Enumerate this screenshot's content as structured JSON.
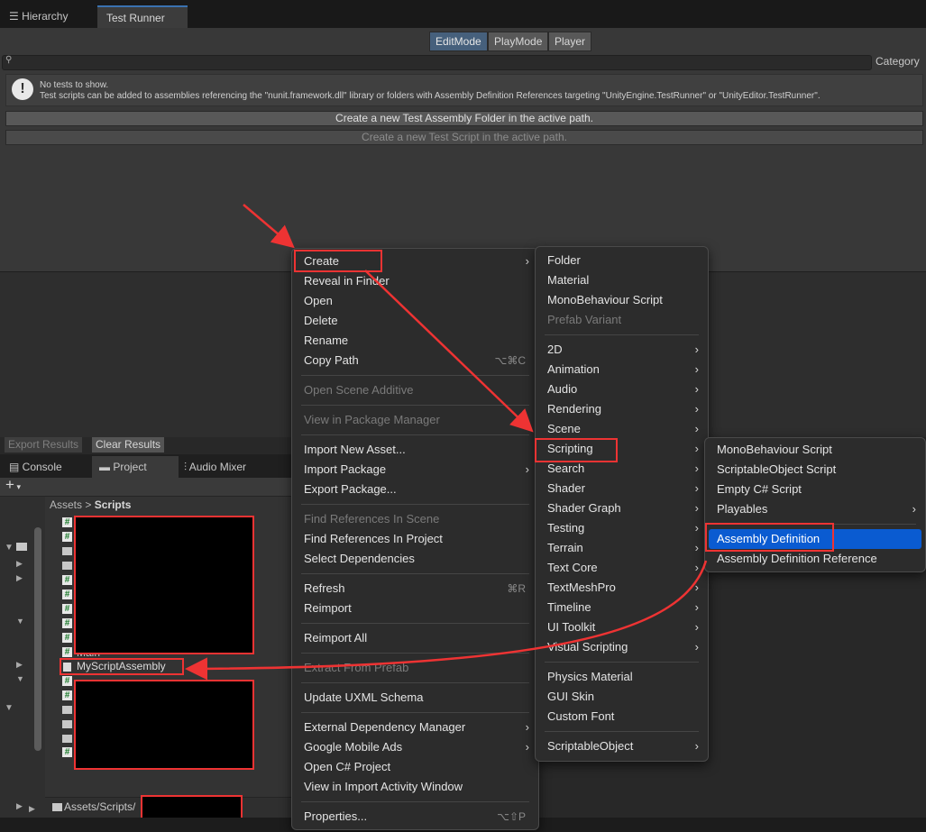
{
  "tabs": {
    "hierarchy": "Hierarchy",
    "hierarchy_icon": "list-icon",
    "test_runner": "Test Runner"
  },
  "test_runner": {
    "modes": [
      "EditMode",
      "PlayMode",
      "Player"
    ],
    "category": "Category",
    "info_line1": "No tests to show.",
    "info_line2": "Test scripts can be added to assemblies referencing the \"nunit.framework.dll\" library or folders with Assembly Definition References targeting \"UnityEngine.TestRunner\" or \"UnityEditor.TestRunner\".",
    "create_folder": "Create a new Test Assembly Folder in the active path.",
    "create_script": "Create a new Test Script in the active path.",
    "export_results": "Export Results",
    "clear_results": "Clear Results"
  },
  "bottom_tabs": [
    "Console",
    "Project",
    "Audio Mixer"
  ],
  "project": {
    "add": "+",
    "breadcrumb_root": "Assets",
    "breadcrumb_sep": ">",
    "breadcrumb_current": "Scripts",
    "item_main": "Main",
    "item_assembly": "MyScriptAssembly",
    "path": "Assets/Scripts/"
  },
  "context_menu": {
    "items": [
      {
        "label": "Create",
        "arrow": true
      },
      {
        "label": "Reveal in Finder"
      },
      {
        "label": "Open"
      },
      {
        "label": "Delete"
      },
      {
        "label": "Rename"
      },
      {
        "label": "Copy Path",
        "shortcut": "⌥⌘C"
      },
      {
        "label": "Open Scene Additive",
        "disabled": true
      },
      {
        "label": "View in Package Manager",
        "disabled": true
      },
      {
        "label": "Import New Asset..."
      },
      {
        "label": "Import Package",
        "arrow": true
      },
      {
        "label": "Export Package..."
      },
      {
        "label": "Find References In Scene",
        "disabled": true
      },
      {
        "label": "Find References In Project"
      },
      {
        "label": "Select Dependencies"
      },
      {
        "label": "Refresh",
        "shortcut": "⌘R"
      },
      {
        "label": "Reimport"
      },
      {
        "label": "Reimport All"
      },
      {
        "label": "Extract From Prefab",
        "disabled": true
      },
      {
        "label": "Update UXML Schema"
      },
      {
        "label": "External Dependency Manager",
        "arrow": true
      },
      {
        "label": "Google Mobile Ads",
        "arrow": true
      },
      {
        "label": "Open C# Project"
      },
      {
        "label": "View in Import Activity Window"
      },
      {
        "label": "Properties...",
        "shortcut": "⌥⇧P"
      }
    ]
  },
  "create_menu": {
    "items": [
      {
        "label": "Folder"
      },
      {
        "label": "Material"
      },
      {
        "label": "MonoBehaviour Script"
      },
      {
        "label": "Prefab Variant",
        "disabled": true
      },
      {
        "label": "2D",
        "arrow": true
      },
      {
        "label": "Animation",
        "arrow": true
      },
      {
        "label": "Audio",
        "arrow": true
      },
      {
        "label": "Rendering",
        "arrow": true
      },
      {
        "label": "Scene",
        "arrow": true
      },
      {
        "label": "Scripting",
        "arrow": true
      },
      {
        "label": "Search",
        "arrow": true
      },
      {
        "label": "Shader",
        "arrow": true
      },
      {
        "label": "Shader Graph",
        "arrow": true
      },
      {
        "label": "Testing",
        "arrow": true
      },
      {
        "label": "Terrain",
        "arrow": true
      },
      {
        "label": "Text Core",
        "arrow": true
      },
      {
        "label": "TextMeshPro",
        "arrow": true
      },
      {
        "label": "Timeline",
        "arrow": true
      },
      {
        "label": "UI Toolkit",
        "arrow": true
      },
      {
        "label": "Visual Scripting",
        "arrow": true
      },
      {
        "label": "Physics Material"
      },
      {
        "label": "GUI Skin"
      },
      {
        "label": "Custom Font"
      },
      {
        "label": "ScriptableObject",
        "arrow": true
      }
    ]
  },
  "scripting_menu": {
    "items": [
      {
        "label": "MonoBehaviour Script"
      },
      {
        "label": "ScriptableObject Script"
      },
      {
        "label": "Empty C# Script"
      },
      {
        "label": "Playables",
        "arrow": true
      },
      {
        "label": "Assembly Definition",
        "highlighted": true
      },
      {
        "label": "Assembly Definition Reference"
      }
    ]
  },
  "colors": {
    "highlight": "#0a5bd1",
    "annotation": "#e33333"
  }
}
